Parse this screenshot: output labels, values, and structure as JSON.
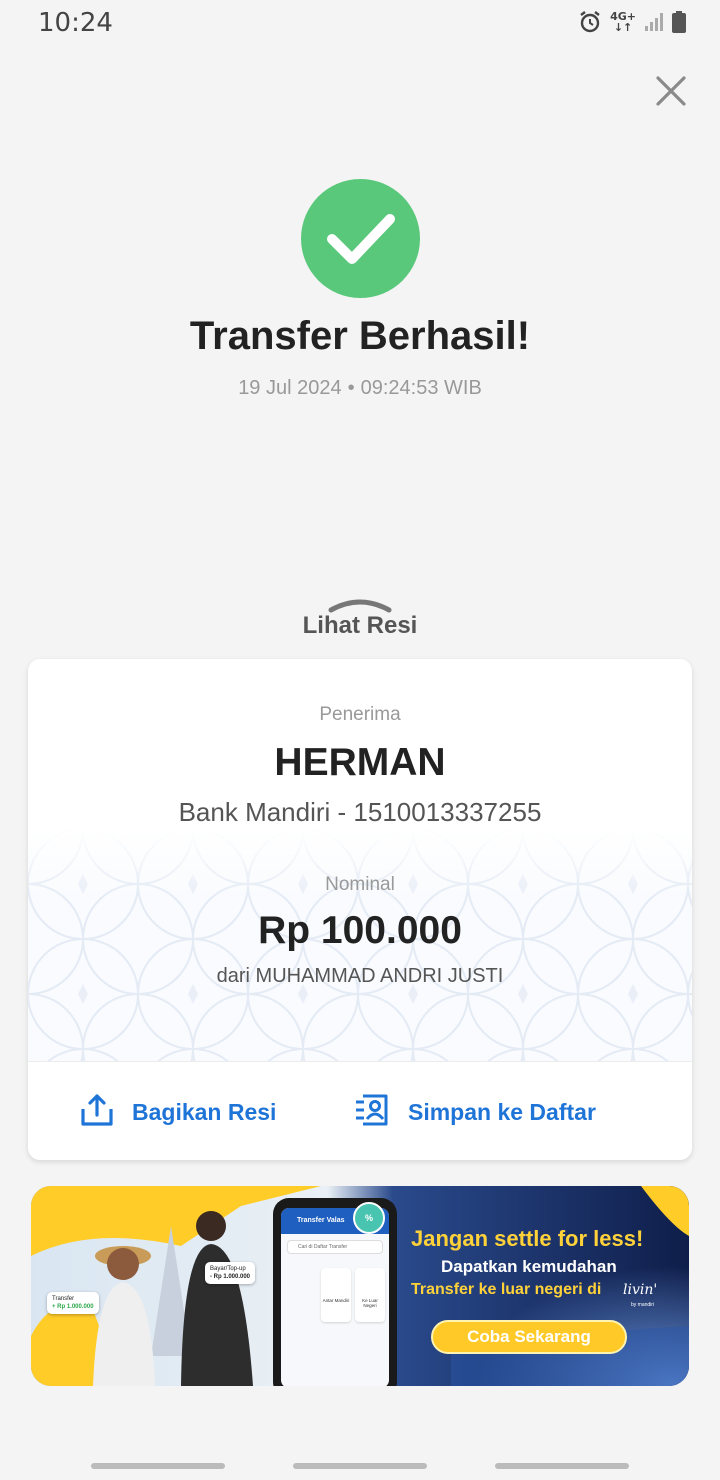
{
  "status_bar": {
    "time": "10:24",
    "network_top": "4G+",
    "network_bottom": "↓↑",
    "icons": [
      "alarm-icon",
      "network-4g-icon",
      "signal-icon",
      "battery-icon"
    ]
  },
  "header": {
    "close_icon": "close-icon"
  },
  "result": {
    "icon": "check-circle-icon",
    "title": "Transfer Berhasil!",
    "date": "19 Jul 2024",
    "separator": "•",
    "time": "09:24:53 WIB"
  },
  "receipt_toggle": {
    "icon": "chevron-up-icon",
    "label": "Lihat Resi"
  },
  "receipt": {
    "recipient_label": "Penerima",
    "recipient_name": "HERMAN",
    "recipient_bank": "Bank Mandiri - 1510013337255",
    "amount_label": "Nominal",
    "amount": "Rp 100.000",
    "sender": "dari MUHAMMAD ANDRI JUSTI",
    "share_label": "Bagikan Resi",
    "save_label": "Simpan ke Daftar"
  },
  "promo": {
    "headline": "Jangan settle for less!",
    "sub1": "Dapatkan kemudahan",
    "sub2": "Transfer ke luar negeri di",
    "brand": "livin'",
    "brand_sub": "by mandiri",
    "cta": "Coba Sekarang",
    "phone_title": "Transfer Valas",
    "phone_search": "Cari di Daftar Transfer",
    "tile_1": "Antar Mandiri",
    "tile_2": "Ke Luar Negeri",
    "chip_1_label": "Bayar/Top-up",
    "chip_1_amount": "- Rp 1.000.000",
    "chip_2_label": "Transfer",
    "chip_2_amount": "+ Rp 1.000.000",
    "colors": {
      "primary": "#1f5fbf",
      "accent": "#ffc928"
    }
  },
  "colors": {
    "success": "#5ac87a",
    "link": "#1f74d8",
    "text_dark": "#222222",
    "text_muted": "#999999"
  }
}
